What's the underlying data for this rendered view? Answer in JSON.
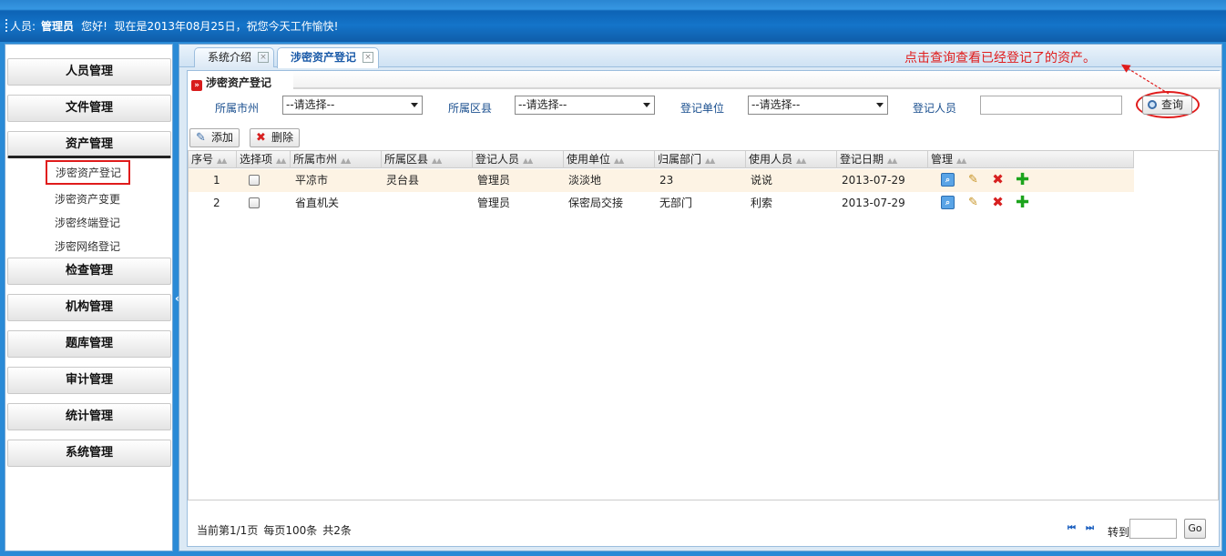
{
  "header": {
    "user_label": "人员:",
    "user_name": "管理员",
    "greeting": "您好!",
    "date_text": "现在是2013年08月25日，祝您今天工作愉快!"
  },
  "sidebar": {
    "menus": [
      {
        "label": "人员管理"
      },
      {
        "label": "文件管理"
      },
      {
        "label": "资产管理"
      },
      {
        "label": "检查管理"
      },
      {
        "label": "机构管理"
      },
      {
        "label": "题库管理"
      },
      {
        "label": "审计管理"
      },
      {
        "label": "统计管理"
      },
      {
        "label": "系统管理"
      }
    ],
    "asset_sub_items": [
      {
        "label": "涉密资产登记",
        "active": true
      },
      {
        "label": "涉密资产变更"
      },
      {
        "label": "涉密终端登记"
      },
      {
        "label": "涉密网络登记"
      }
    ],
    "collapse_glyph": "«"
  },
  "tabs": [
    {
      "label": "系统介绍",
      "close": "×"
    },
    {
      "label": "涉密资产登记",
      "close": "×",
      "active": true
    }
  ],
  "annotation": "点击查询查看已经登记了的资产。",
  "panel": {
    "title": "涉密资产登记",
    "filters": {
      "city_label": "所属市州",
      "city_value": "--请选择--",
      "district_label": "所属区县",
      "district_value": "--请选择--",
      "unit_label": "登记单位",
      "unit_value": "--请选择--",
      "person_label": "登记人员",
      "person_value": ""
    },
    "query_label": "查询",
    "add_label": "添加",
    "delete_label": "删除"
  },
  "table": {
    "columns": [
      "序号",
      "选择项",
      "所属市州",
      "所属区县",
      "登记人员",
      "使用单位",
      "归属部门",
      "使用人员",
      "登记日期",
      "管理"
    ],
    "rows": [
      {
        "no": "1",
        "city": "平凉市",
        "district": "灵台县",
        "registrar": "管理员",
        "unit": "淡淡地",
        "dept": "23",
        "user": "说说",
        "date": "2013-07-29"
      },
      {
        "no": "2",
        "city": "省直机关",
        "district": "",
        "registrar": "管理员",
        "unit": "保密局交接",
        "dept": "无部门",
        "user": "利索",
        "date": "2013-07-29"
      }
    ]
  },
  "pager": {
    "current": "当前第1/1页",
    "per_page": "每页100条",
    "total": "共2条",
    "first_glyph": "⏮",
    "last_glyph": "⏭",
    "goto_label": "转到",
    "go_label": "Go"
  },
  "colors": {
    "header_blue": "#1474c9",
    "annotation_red": "#e01c1c",
    "row_highlight": "#fdf3e4"
  }
}
